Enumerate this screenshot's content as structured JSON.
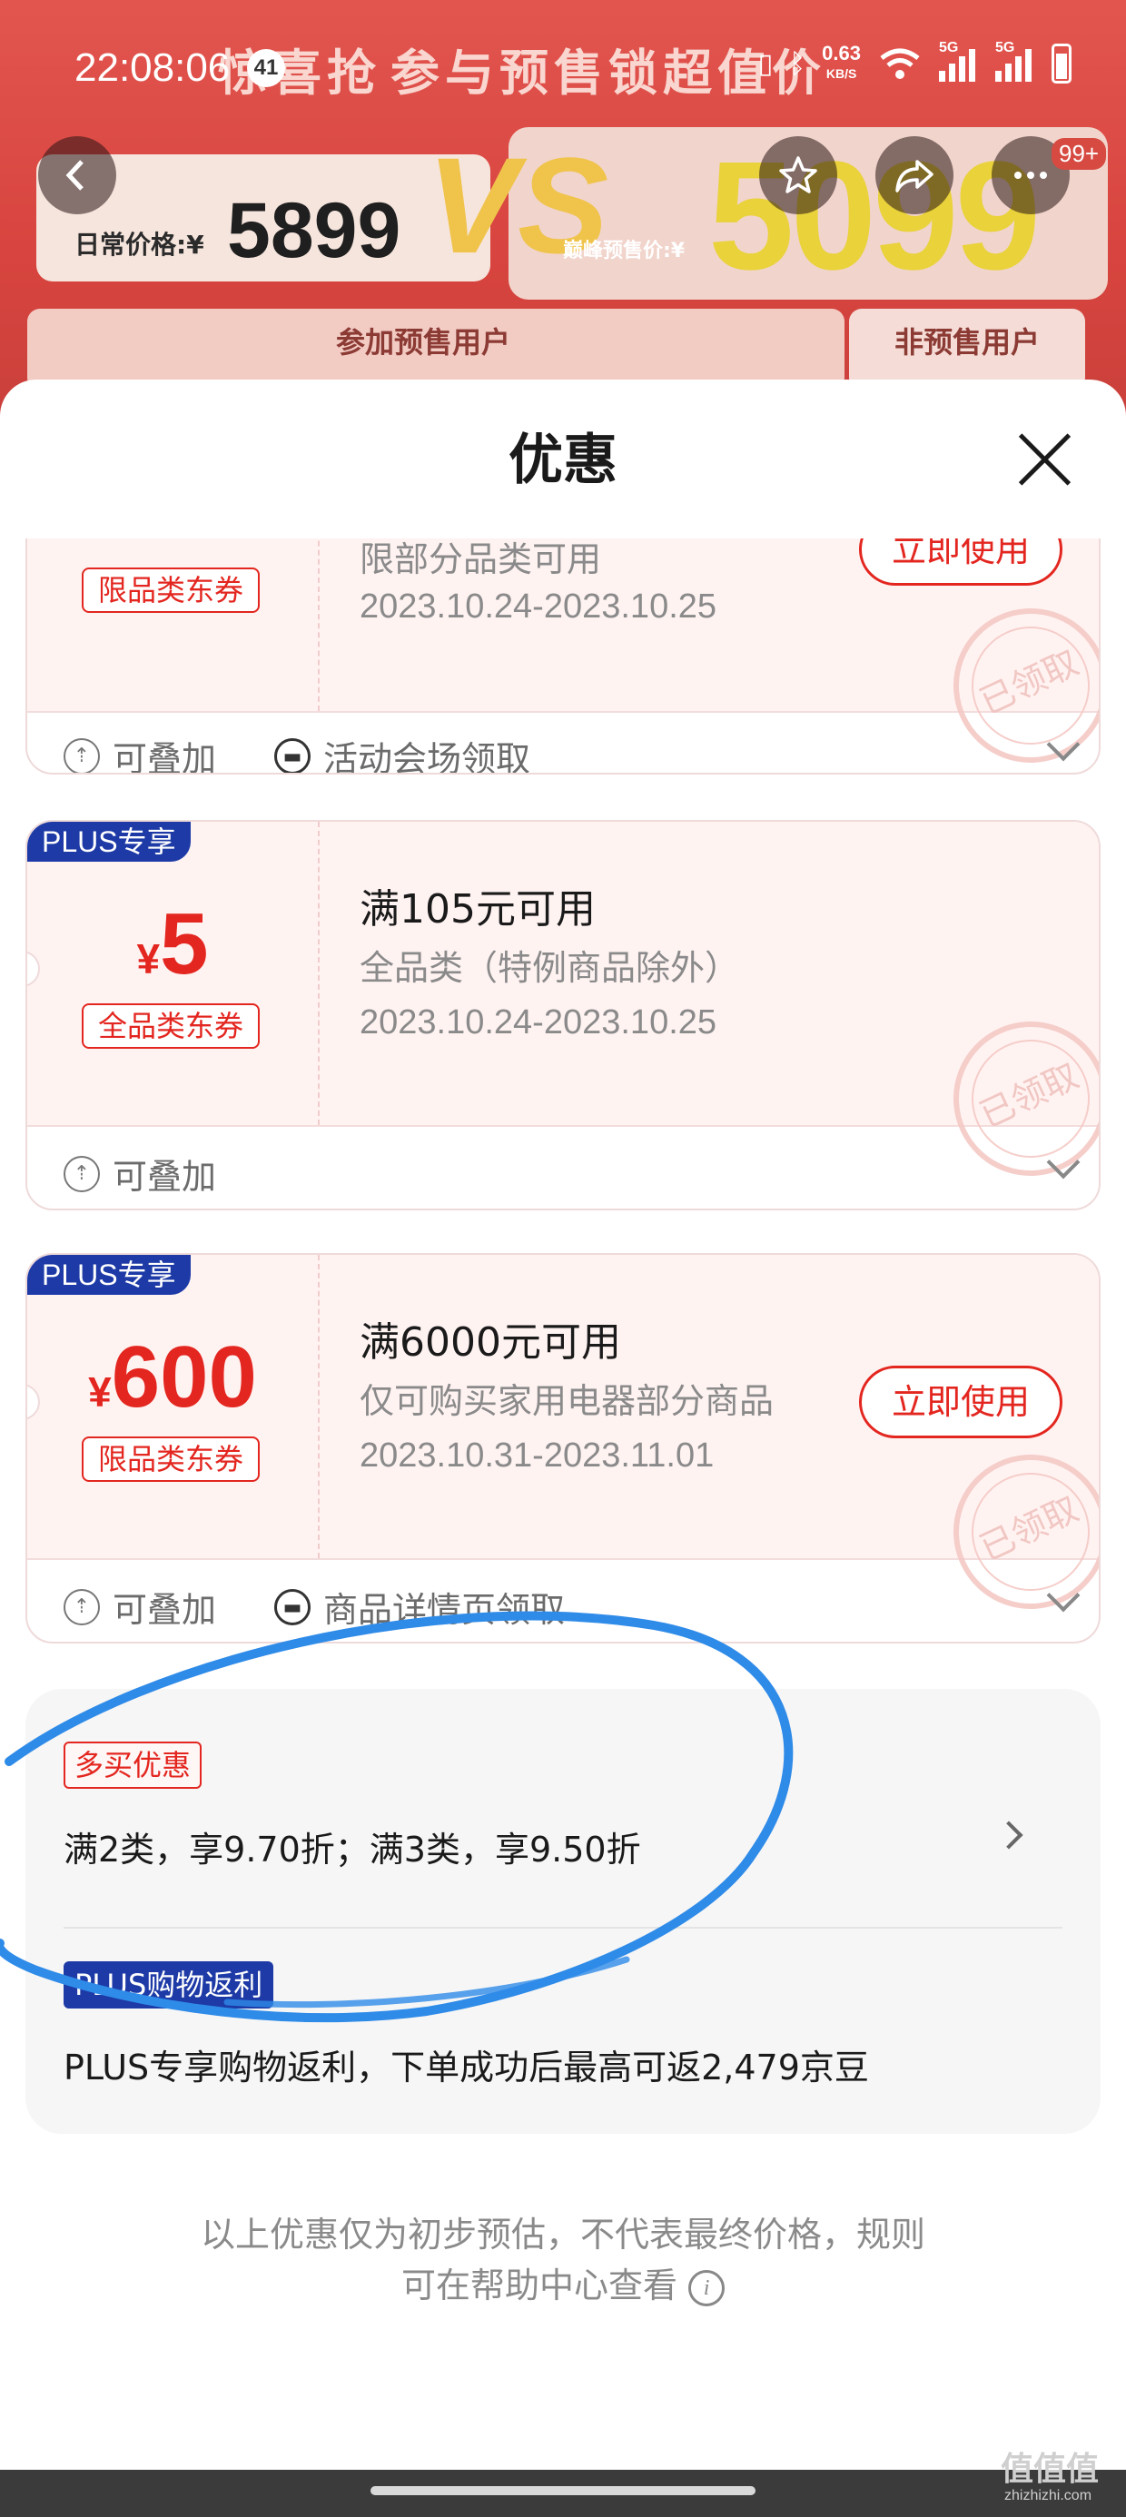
{
  "status_bar": {
    "time": "22:08:06",
    "notification_count": "41",
    "speed_value": "0.63",
    "speed_unit": "KB/S",
    "network_1": "5G",
    "network_2": "5G"
  },
  "background": {
    "banner_left": "惊喜抢",
    "banner_right": "参与预售锁超值价",
    "daily_price_label": "日常价格:¥",
    "daily_price": "5899",
    "vs": "VS",
    "peak_price_label": "巅峰预售价:¥",
    "peak_price": "5099",
    "tab_presale": "参加预售用户",
    "tab_non_presale": "非预售用户",
    "nav_badge": "99+"
  },
  "sheet": {
    "title": "优惠",
    "coupons": [
      {
        "tag": "限品类东券",
        "condition": "",
        "scope": "限部分品类可用",
        "dates": "2023.10.24-2023.10.25",
        "use_button": "立即使用",
        "stamp": "已领取",
        "stackable": "可叠加",
        "source": "活动会场领取"
      },
      {
        "plus_tag": "PLUS专享",
        "currency": "¥",
        "amount": "5",
        "tag": "全品类东券",
        "condition": "满105元可用",
        "scope": "全品类（特例商品除外）",
        "dates": "2023.10.24-2023.10.25",
        "stamp": "已领取",
        "stackable": "可叠加"
      },
      {
        "plus_tag": "PLUS专享",
        "currency": "¥",
        "amount": "600",
        "tag": "限品类东券",
        "condition": "满6000元可用",
        "scope": "仅可购买家用电器部分商品",
        "dates": "2023.10.31-2023.11.01",
        "use_button": "立即使用",
        "stamp": "已领取",
        "stackable": "可叠加",
        "source": "商品详情页领取"
      }
    ],
    "promo": {
      "multi_buy_tag": "多买优惠",
      "multi_buy_text": "满2类，享9.70折；满3类，享9.50折",
      "plus_rebate_tag": "PLUS购物返利",
      "plus_rebate_text": "PLUS专享购物返利，下单成功后最高可返2,479京豆"
    },
    "disclaimer_line1": "以上优惠仅为初步预估，不代表最终价格，规则",
    "disclaimer_line2": "可在帮助中心查看"
  },
  "watermark": {
    "main": "值值值",
    "sub": "zhizhizhi.com"
  },
  "colors": {
    "accent_red": "#e3261f",
    "plus_blue": "#1d3aa6",
    "annotation_blue": "#2f8be8"
  }
}
